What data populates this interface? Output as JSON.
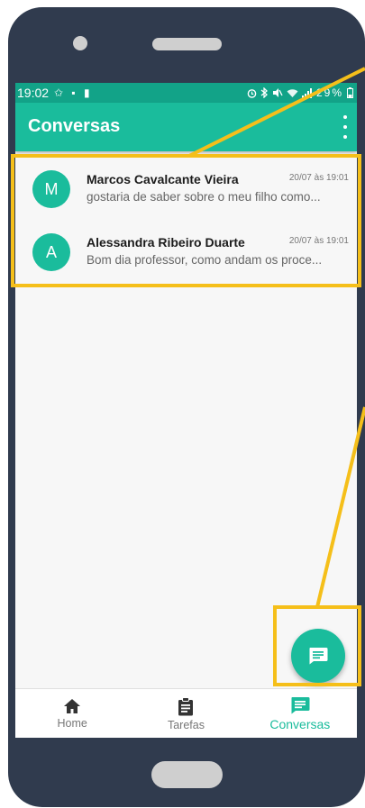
{
  "status_bar": {
    "time": "19:02",
    "left_icons": "✩ ▪ ▮",
    "battery_text": "29%"
  },
  "app_bar": {
    "title": "Conversas"
  },
  "conversations": [
    {
      "initial": "M",
      "name": "Marcos Cavalcante Vieira",
      "time": "20/07 às 19:01",
      "preview": "gostaria de saber sobre o meu filho como..."
    },
    {
      "initial": "A",
      "name": "Alessandra Ribeiro Duarte",
      "time": "20/07 às 19:01",
      "preview": "Bom dia professor, como andam os proce..."
    }
  ],
  "bottom_nav": [
    {
      "label": "Home",
      "icon": "home-icon",
      "active": false
    },
    {
      "label": "Tarefas",
      "icon": "clipboard-icon",
      "active": false
    },
    {
      "label": "Conversas",
      "icon": "chat-icon",
      "active": true
    }
  ],
  "colors": {
    "accent": "#1abc9c",
    "status_bar": "#12a388",
    "device_frame": "#303b4e",
    "highlight": "#f5bf1a"
  }
}
